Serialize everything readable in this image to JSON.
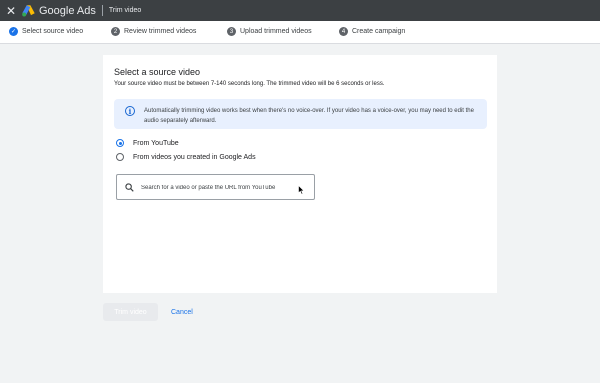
{
  "header": {
    "close_icon": "close-icon",
    "logo_icon": "google-ads-logo-icon",
    "brand": "Google Ads",
    "subtitle": "Trim video"
  },
  "steps": [
    {
      "number": "✓",
      "label": "Select source video",
      "state": "done"
    },
    {
      "number": "2",
      "label": "Review trimmed videos",
      "state": "todo"
    },
    {
      "number": "3",
      "label": "Upload trimmed videos",
      "state": "todo"
    },
    {
      "number": "4",
      "label": "Create campaign",
      "state": "todo"
    }
  ],
  "card": {
    "title": "Select a source video",
    "description": "Your source video must be between 7-140 seconds long. The trimmed video will be 6 seconds or less.",
    "notice": {
      "icon": "info-icon",
      "text": "Automatically trimming video works best when there's no voice-over. If your video has a voice-over, you may need to edit the audio separately afterward."
    },
    "source_options": [
      {
        "label": "From YouTube",
        "selected": true
      },
      {
        "label": "From videos you created in Google Ads",
        "selected": false
      }
    ],
    "search": {
      "icon": "search-icon",
      "value": "",
      "placeholder": "Search for a video or paste the URL from YouTube"
    }
  },
  "actions": {
    "trim_label": "Trim video",
    "trim_enabled": false,
    "cancel_label": "Cancel"
  },
  "colors": {
    "accent": "#1a73e8",
    "topbar": "#3c4043",
    "notice_bg": "#e8f0fe",
    "page_bg": "#f1f3f4"
  }
}
